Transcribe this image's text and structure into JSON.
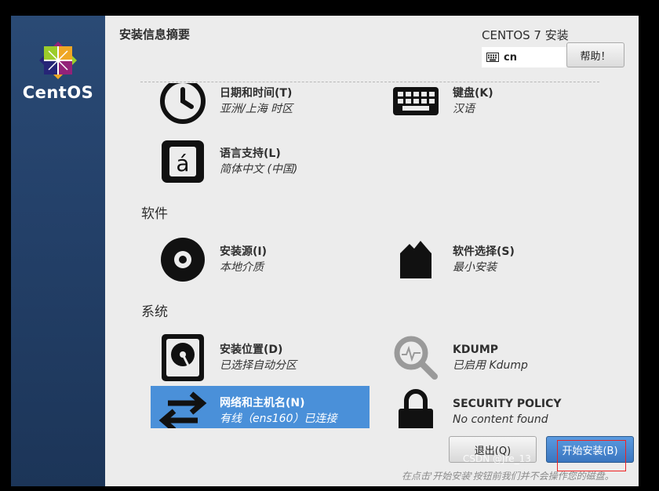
{
  "sidebar": {
    "logo_text": "CentOS"
  },
  "header": {
    "title": "安装信息摘要",
    "product": "CENTOS 7 安装",
    "keyboard_layout": "cn",
    "help_label": "帮助！"
  },
  "sections": {
    "software": "软件",
    "system": "系统"
  },
  "spokes": {
    "datetime": {
      "title": "日期和时间(T)",
      "status": "亚洲/上海 时区"
    },
    "keyboard": {
      "title": "键盘(K)",
      "status": "汉语"
    },
    "language": {
      "title": "语言支持(L)",
      "status": "简体中文 (中国)"
    },
    "source": {
      "title": "安装源(I)",
      "status": "本地介质"
    },
    "software_selection": {
      "title": "软件选择(S)",
      "status": "最小安装"
    },
    "destination": {
      "title": "安装位置(D)",
      "status": "已选择自动分区"
    },
    "kdump": {
      "title": "KDUMP",
      "status": "已启用 Kdump"
    },
    "network": {
      "title": "网络和主机名(N)",
      "status": "有线（ens160）已连接"
    },
    "security": {
      "title": "SECURITY POLICY",
      "status": "No content found"
    }
  },
  "footer": {
    "quit_label": "退出(Q)",
    "begin_label": "开始安装(B)",
    "note": "在点击'开始安装'按钮前我们并不会操作您的磁盘。",
    "watermark": "CSDN @Jre_13"
  },
  "colors": {
    "sidebar": "#24416a",
    "selected": "#4a90d9",
    "primary_button": "#3a76c0",
    "highlight_box": "#ee2222"
  }
}
